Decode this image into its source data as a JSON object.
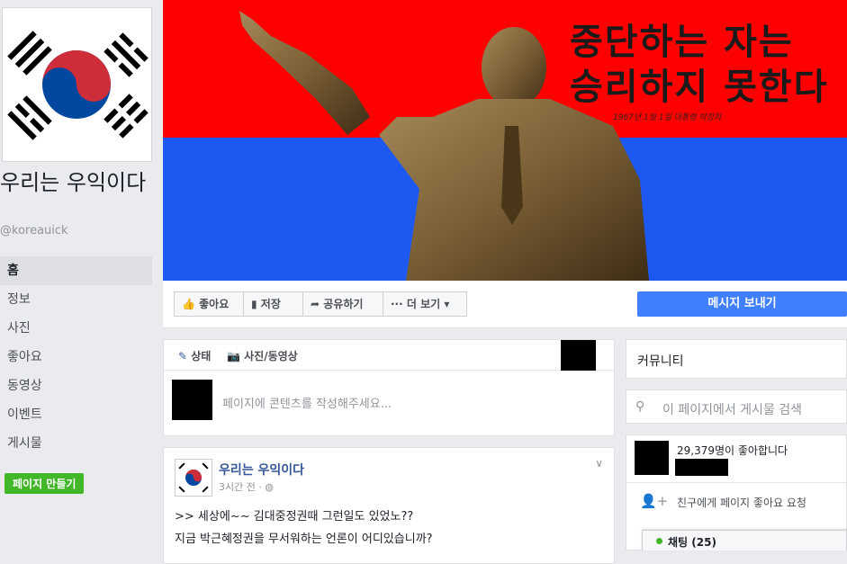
{
  "page": {
    "name": "우리는 우익이다",
    "handle": "@koreauick"
  },
  "sidebar": {
    "items": [
      {
        "label": "홈",
        "active": true
      },
      {
        "label": "정보"
      },
      {
        "label": "사진"
      },
      {
        "label": "좋아요"
      },
      {
        "label": "동영상"
      },
      {
        "label": "이벤트"
      },
      {
        "label": "게시물"
      }
    ],
    "create_page_label": "페이지 만들기"
  },
  "cover": {
    "slogan_line1": "중단하는 자는",
    "slogan_line2": "승리하지 못한다",
    "signature": "1967년 1월 1일   대통령   박정희"
  },
  "actions": {
    "like": "좋아요",
    "save": "저장",
    "share": "공유하기",
    "more": "더 보기",
    "message": "메시지 보내기"
  },
  "composer": {
    "tab_status": "상태",
    "tab_photo": "사진/동영상",
    "placeholder": "페이지에 콘텐츠를 작성해주세요..."
  },
  "post": {
    "author": "우리는 우익이다",
    "time": "3시간 전 · ",
    "line1": ">> 세상에~~ 김대중정권때 그런일도 있었노??",
    "line2": "지금 박근혜정권을 무서워하는 언론이 어디있습니까?"
  },
  "right": {
    "community": "커뮤니티",
    "search_placeholder": "이 페이지에서 게시물 검색",
    "likes_count": "29,379명이 좋아합니다",
    "invite": "친구에게 페이지 좋아요 요청"
  },
  "chat": {
    "label": "채팅 (25)"
  },
  "colors": {
    "flag_red": "#cd2e3a",
    "flag_blue": "#0047a0",
    "cover_red": "#fe0000",
    "cover_blue": "#1d59f0",
    "accent": "#4080ff",
    "green": "#42b72a"
  }
}
